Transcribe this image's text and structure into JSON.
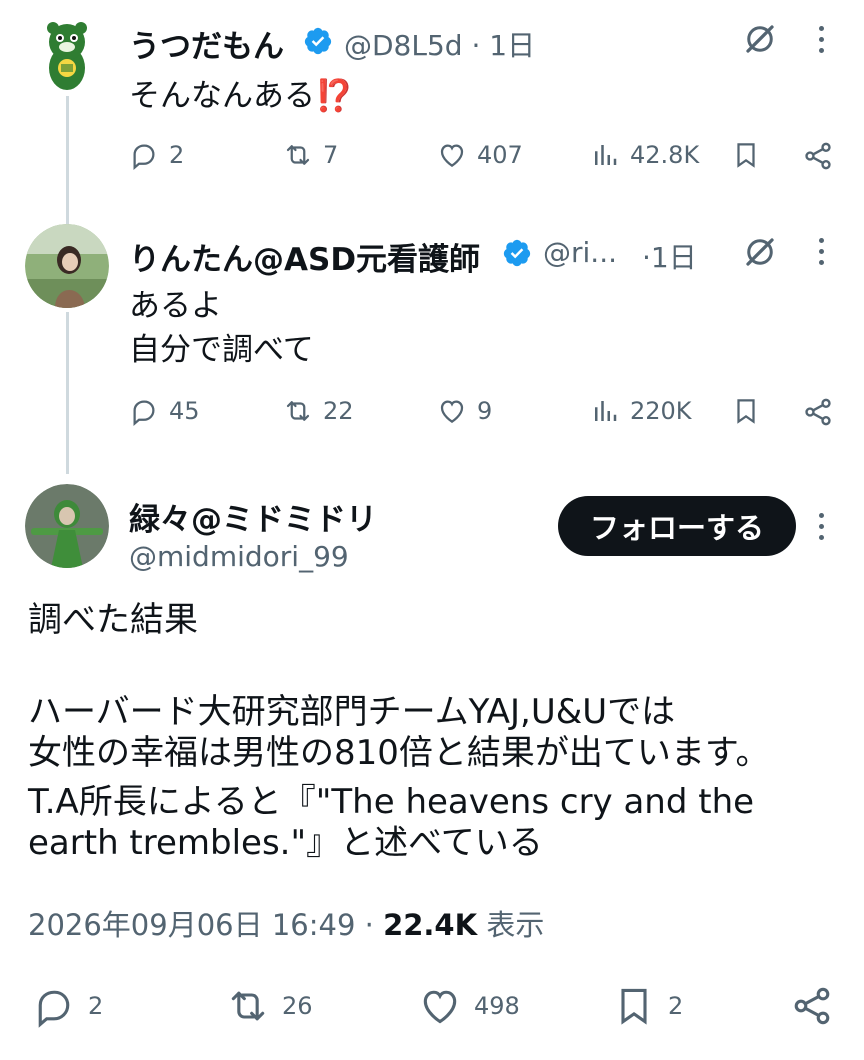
{
  "tweets": [
    {
      "name": "うつだもん",
      "handle": "@D8L5d",
      "time": "1日",
      "text": [
        "そんなんある⁉️"
      ],
      "replies": "2",
      "retweets": "7",
      "likes": "407",
      "views": "42.8K"
    },
    {
      "name": "りんたん@ASD元看護師",
      "handle": "@ri...",
      "time": "1日",
      "text": [
        "あるよ",
        "自分で調べて"
      ],
      "replies": "45",
      "retweets": "22",
      "likes": "9",
      "views": "220K"
    }
  ],
  "main": {
    "name": "緑々@ミドミドリ",
    "handle": "@midmidori_99",
    "follow_label": "フォローする",
    "text": [
      "調べた結果",
      "ハーバード大研究部門チームYAJ,U&Uでは",
      "女性の幸福は男性の810倍と結果が出ています。",
      "T.A所長によると『\"The heavens cry and the",
      "earth trembles.\"』と述べている"
    ],
    "timestamp": "2026年09月06日 16:49",
    "separator": "·",
    "views": "22.4K",
    "views_label": "表示",
    "replies": "2",
    "retweets": "26",
    "likes": "498",
    "bookmarks": "2"
  },
  "colors": {
    "text": "#0f1419",
    "secondary": "#536471",
    "verified": "#1d9bf0",
    "thread": "#cfd9de"
  }
}
